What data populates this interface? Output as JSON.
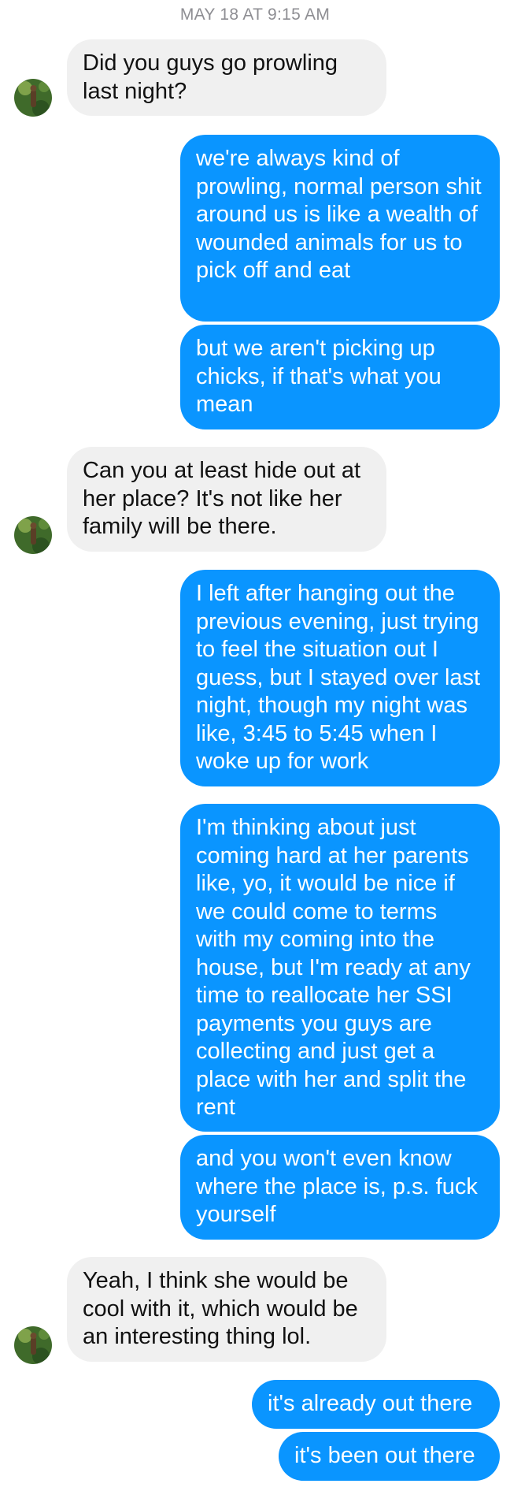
{
  "timestamp": "MAY 18 AT 9:15 AM",
  "colors": {
    "outgoing_bubble": "#0a95ff",
    "incoming_bubble": "#f0f0f0",
    "timestamp_text": "#8e8e93"
  },
  "contact": {
    "avatar_icon": "contact-avatar-photo"
  },
  "messages": [
    {
      "from": "contact",
      "text": "Did you guys go prowling last night?"
    },
    {
      "from": "me",
      "text": "we're always kind of prowling, normal person shit around us is like a wealth of wounded animals for us to pick off and eat"
    },
    {
      "from": "me",
      "text": "but we aren't picking up chicks, if that's what you mean"
    },
    {
      "from": "contact",
      "text": "Can you at least hide out at her place? It's not like her family will be there."
    },
    {
      "from": "me",
      "text": "I left after hanging out the previous evening, just trying to feel the situation out I guess, but I stayed over last night, though my night was like, 3:45 to 5:45 when I woke up for work"
    },
    {
      "from": "me",
      "text": "I'm thinking about just coming hard at her parents like, yo, it would be nice if we could come to terms with my coming into the house, but I'm ready at any time to reallocate her SSI payments you guys are collecting and just get a place with her and split the rent"
    },
    {
      "from": "me",
      "text": "and you won't even know where the place is, p.s. fuck yourself"
    },
    {
      "from": "contact",
      "text": "Yeah, I think she would be cool with it, which would be an interesting thing lol."
    },
    {
      "from": "me",
      "text": "it's already out there"
    },
    {
      "from": "me",
      "text": "it's been out there"
    }
  ]
}
